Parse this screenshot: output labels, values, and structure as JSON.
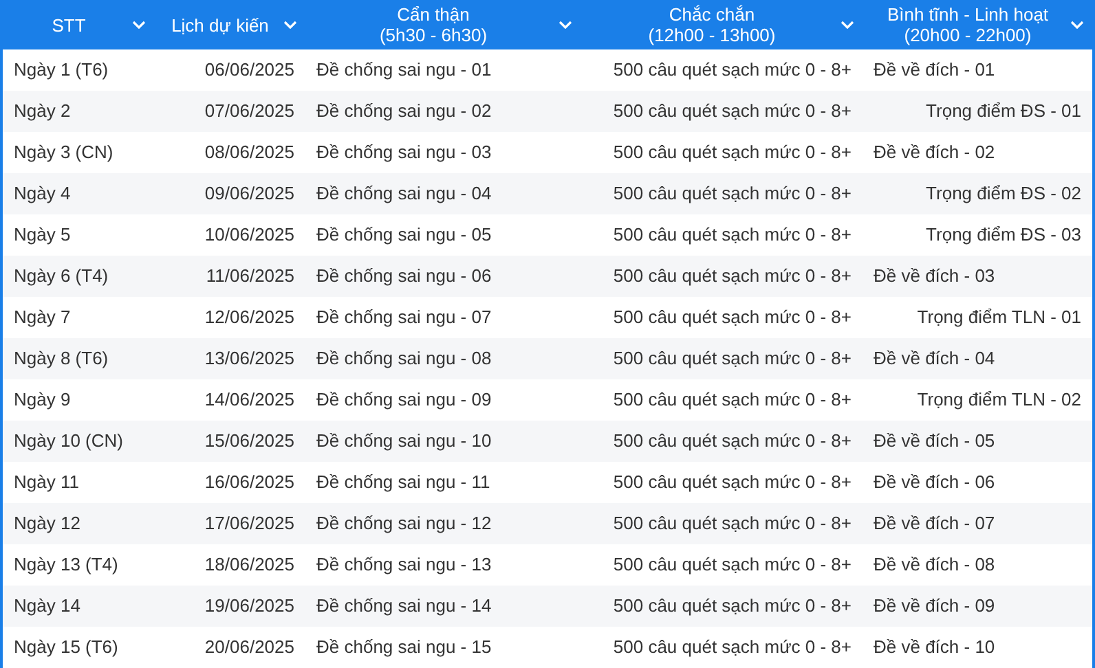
{
  "columns": [
    {
      "label": "STT"
    },
    {
      "label": "Lịch dự kiến"
    },
    {
      "label": "Cẩn thận",
      "sub": "(5h30 - 6h30)"
    },
    {
      "label": "Chắc chắn",
      "sub": "(12h00 - 13h00)"
    },
    {
      "label": "Bình tĩnh - Linh hoạt",
      "sub": "(20h00 - 22h00)"
    }
  ],
  "rows": [
    {
      "day": "Ngày 1 (T6)",
      "date": "06/06/2025",
      "morning": "Đề chống sai ngu - 01",
      "noon": "500 câu quét sạch mức 0 - 8+",
      "evening": {
        "text": "Đề về đích - 01",
        "kind": "review"
      }
    },
    {
      "day": "Ngày 2",
      "date": "07/06/2025",
      "morning": "Đề chống sai ngu - 02",
      "noon": "500 câu quét sạch mức 0 - 8+",
      "evening": {
        "text": "Trọng điểm ĐS - 01",
        "kind": "focus"
      }
    },
    {
      "day": "Ngày 3 (CN)",
      "date": "08/06/2025",
      "morning": "Đề chống sai ngu - 03",
      "noon": "500 câu quét sạch mức 0 - 8+",
      "evening": {
        "text": "Đề về đích - 02",
        "kind": "review"
      }
    },
    {
      "day": "Ngày 4",
      "date": "09/06/2025",
      "morning": "Đề chống sai ngu - 04",
      "noon": "500 câu quét sạch mức 0 - 8+",
      "evening": {
        "text": "Trọng điểm ĐS - 02",
        "kind": "focus"
      }
    },
    {
      "day": "Ngày 5",
      "date": "10/06/2025",
      "morning": "Đề chống sai ngu - 05",
      "noon": "500 câu quét sạch mức 0 - 8+",
      "evening": {
        "text": "Trọng điểm ĐS - 03",
        "kind": "focus"
      }
    },
    {
      "day": "Ngày 6 (T4)",
      "date": "11/06/2025",
      "morning": "Đề chống sai ngu - 06",
      "noon": "500 câu quét sạch mức 0 - 8+",
      "evening": {
        "text": "Đề về đích - 03",
        "kind": "review"
      }
    },
    {
      "day": "Ngày 7",
      "date": "12/06/2025",
      "morning": "Đề chống sai ngu - 07",
      "noon": "500 câu quét sạch mức 0 - 8+",
      "evening": {
        "text": "Trọng điểm TLN - 01",
        "kind": "focus"
      }
    },
    {
      "day": "Ngày 8 (T6)",
      "date": "13/06/2025",
      "morning": "Đề chống sai ngu - 08",
      "noon": "500 câu quét sạch mức 0 - 8+",
      "evening": {
        "text": "Đề về đích - 04",
        "kind": "review"
      }
    },
    {
      "day": "Ngày 9",
      "date": "14/06/2025",
      "morning": "Đề chống sai ngu - 09",
      "noon": "500 câu quét sạch mức 0 - 8+",
      "evening": {
        "text": "Trọng điểm TLN - 02",
        "kind": "focus"
      }
    },
    {
      "day": "Ngày 10 (CN)",
      "date": "15/06/2025",
      "morning": "Đề chống sai ngu - 10",
      "noon": "500 câu quét sạch mức 0 - 8+",
      "evening": {
        "text": "Đề về đích - 05",
        "kind": "review"
      }
    },
    {
      "day": "Ngày 11",
      "date": "16/06/2025",
      "morning": "Đề chống sai ngu - 11",
      "noon": "500 câu quét sạch mức 0 - 8+",
      "evening": {
        "text": "Đề về đích - 06",
        "kind": "review"
      }
    },
    {
      "day": "Ngày 12",
      "date": "17/06/2025",
      "morning": "Đề chống sai ngu - 12",
      "noon": "500 câu quét sạch mức 0 - 8+",
      "evening": {
        "text": "Đề về đích - 07",
        "kind": "review"
      }
    },
    {
      "day": "Ngày 13 (T4)",
      "date": "18/06/2025",
      "morning": "Đề chống sai ngu - 13",
      "noon": "500 câu quét sạch mức 0 - 8+",
      "evening": {
        "text": "Đề về đích - 08",
        "kind": "review"
      }
    },
    {
      "day": "Ngày 14",
      "date": "19/06/2025",
      "morning": "Đề chống sai ngu - 14",
      "noon": "500 câu quét sạch mức 0 - 8+",
      "evening": {
        "text": "Đề về đích - 09",
        "kind": "review"
      }
    },
    {
      "day": "Ngày 15 (T6)",
      "date": "20/06/2025",
      "morning": "Đề chống sai ngu - 15",
      "noon": "500 câu quét sạch mức 0 - 8+",
      "evening": {
        "text": "Đề về đích - 10",
        "kind": "review"
      }
    }
  ]
}
